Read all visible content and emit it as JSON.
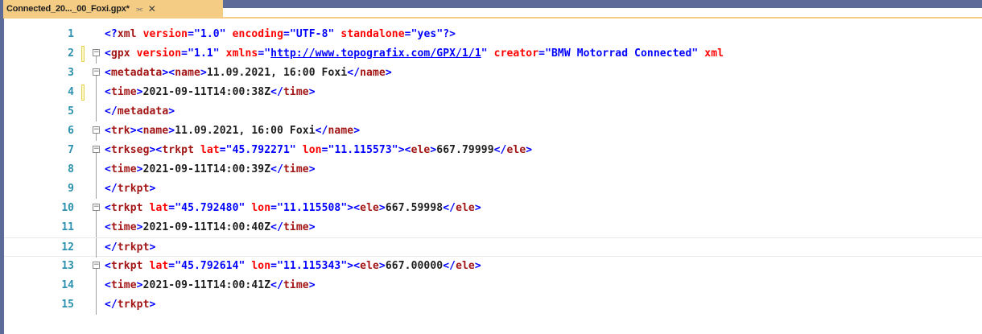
{
  "tab": {
    "title": "Connected_20..._00_Foxi.gpx*",
    "pin_icon": "pin-icon",
    "close_icon": "close-icon"
  },
  "editor": {
    "lines": [
      {
        "num": "1",
        "segments": [
          {
            "t": "<?",
            "c": "br"
          },
          {
            "t": "xml",
            "c": "tag"
          },
          {
            "t": " ",
            "c": "txt"
          },
          {
            "t": "version",
            "c": "attr"
          },
          {
            "t": "=\"",
            "c": "br"
          },
          {
            "t": "1.0",
            "c": "val"
          },
          {
            "t": "\"",
            "c": "br"
          },
          {
            "t": " ",
            "c": "txt"
          },
          {
            "t": "encoding",
            "c": "attr"
          },
          {
            "t": "=\"",
            "c": "br"
          },
          {
            "t": "UTF-8",
            "c": "val"
          },
          {
            "t": "\"",
            "c": "br"
          },
          {
            "t": " ",
            "c": "txt"
          },
          {
            "t": "standalone",
            "c": "attr"
          },
          {
            "t": "=\"",
            "c": "br"
          },
          {
            "t": "yes",
            "c": "val"
          },
          {
            "t": "\"?>",
            "c": "br"
          }
        ]
      },
      {
        "num": "2",
        "segments": [
          {
            "t": "<",
            "c": "br"
          },
          {
            "t": "gpx",
            "c": "tag"
          },
          {
            "t": " ",
            "c": "txt"
          },
          {
            "t": "version",
            "c": "attr"
          },
          {
            "t": "=\"",
            "c": "br"
          },
          {
            "t": "1.1",
            "c": "val"
          },
          {
            "t": "\"",
            "c": "br"
          },
          {
            "t": " ",
            "c": "txt"
          },
          {
            "t": "xmlns",
            "c": "attr"
          },
          {
            "t": "=\"",
            "c": "br"
          },
          {
            "t": "http://www.topografix.com/GPX/1/1",
            "c": "link"
          },
          {
            "t": "\"",
            "c": "br"
          },
          {
            "t": " ",
            "c": "txt"
          },
          {
            "t": "creator",
            "c": "attr"
          },
          {
            "t": "=\"",
            "c": "br"
          },
          {
            "t": "BMW Motorrad Connected",
            "c": "val"
          },
          {
            "t": "\"",
            "c": "br"
          },
          {
            "t": " ",
            "c": "txt"
          },
          {
            "t": "xml",
            "c": "attr"
          }
        ]
      },
      {
        "num": "3",
        "segments": [
          {
            "t": "<",
            "c": "br"
          },
          {
            "t": "metadata",
            "c": "tag"
          },
          {
            "t": "><",
            "c": "br"
          },
          {
            "t": "name",
            "c": "tag"
          },
          {
            "t": ">",
            "c": "br"
          },
          {
            "t": "11.09.2021, 16:00 Foxi",
            "c": "txt"
          },
          {
            "t": "</",
            "c": "br"
          },
          {
            "t": "name",
            "c": "tag"
          },
          {
            "t": ">",
            "c": "br"
          }
        ]
      },
      {
        "num": "4",
        "segments": [
          {
            "t": "<",
            "c": "br"
          },
          {
            "t": "time",
            "c": "tag"
          },
          {
            "t": ">",
            "c": "br"
          },
          {
            "t": "2021-09-11T14:00:38Z",
            "c": "txt"
          },
          {
            "t": "</",
            "c": "br"
          },
          {
            "t": "time",
            "c": "tag"
          },
          {
            "t": ">",
            "c": "br"
          }
        ]
      },
      {
        "num": "5",
        "segments": [
          {
            "t": "</",
            "c": "br"
          },
          {
            "t": "metadata",
            "c": "tag"
          },
          {
            "t": ">",
            "c": "br"
          }
        ]
      },
      {
        "num": "6",
        "segments": [
          {
            "t": "<",
            "c": "br"
          },
          {
            "t": "trk",
            "c": "tag"
          },
          {
            "t": "><",
            "c": "br"
          },
          {
            "t": "name",
            "c": "tag"
          },
          {
            "t": ">",
            "c": "br"
          },
          {
            "t": "11.09.2021, 16:00 Foxi",
            "c": "txt"
          },
          {
            "t": "</",
            "c": "br"
          },
          {
            "t": "name",
            "c": "tag"
          },
          {
            "t": ">",
            "c": "br"
          }
        ]
      },
      {
        "num": "7",
        "segments": [
          {
            "t": "<",
            "c": "br"
          },
          {
            "t": "trkseg",
            "c": "tag"
          },
          {
            "t": "><",
            "c": "br"
          },
          {
            "t": "trkpt",
            "c": "tag"
          },
          {
            "t": " ",
            "c": "txt"
          },
          {
            "t": "lat",
            "c": "attr"
          },
          {
            "t": "=\"",
            "c": "br"
          },
          {
            "t": "45.792271",
            "c": "val"
          },
          {
            "t": "\"",
            "c": "br"
          },
          {
            "t": " ",
            "c": "txt"
          },
          {
            "t": "lon",
            "c": "attr"
          },
          {
            "t": "=\"",
            "c": "br"
          },
          {
            "t": "11.115573",
            "c": "val"
          },
          {
            "t": "\"><",
            "c": "br"
          },
          {
            "t": "ele",
            "c": "tag"
          },
          {
            "t": ">",
            "c": "br"
          },
          {
            "t": "667.79999",
            "c": "txt"
          },
          {
            "t": "</",
            "c": "br"
          },
          {
            "t": "ele",
            "c": "tag"
          },
          {
            "t": ">",
            "c": "br"
          }
        ]
      },
      {
        "num": "8",
        "segments": [
          {
            "t": "<",
            "c": "br"
          },
          {
            "t": "time",
            "c": "tag"
          },
          {
            "t": ">",
            "c": "br"
          },
          {
            "t": "2021-09-11T14:00:39Z",
            "c": "txt"
          },
          {
            "t": "</",
            "c": "br"
          },
          {
            "t": "time",
            "c": "tag"
          },
          {
            "t": ">",
            "c": "br"
          }
        ]
      },
      {
        "num": "9",
        "segments": [
          {
            "t": "</",
            "c": "br"
          },
          {
            "t": "trkpt",
            "c": "tag"
          },
          {
            "t": ">",
            "c": "br"
          }
        ]
      },
      {
        "num": "10",
        "segments": [
          {
            "t": "<",
            "c": "br"
          },
          {
            "t": "trkpt",
            "c": "tag"
          },
          {
            "t": " ",
            "c": "txt"
          },
          {
            "t": "lat",
            "c": "attr"
          },
          {
            "t": "=\"",
            "c": "br"
          },
          {
            "t": "45.792480",
            "c": "val"
          },
          {
            "t": "\"",
            "c": "br"
          },
          {
            "t": " ",
            "c": "txt"
          },
          {
            "t": "lon",
            "c": "attr"
          },
          {
            "t": "=\"",
            "c": "br"
          },
          {
            "t": "11.115508",
            "c": "val"
          },
          {
            "t": "\"><",
            "c": "br"
          },
          {
            "t": "ele",
            "c": "tag"
          },
          {
            "t": ">",
            "c": "br"
          },
          {
            "t": "667.59998",
            "c": "txt"
          },
          {
            "t": "</",
            "c": "br"
          },
          {
            "t": "ele",
            "c": "tag"
          },
          {
            "t": ">",
            "c": "br"
          }
        ]
      },
      {
        "num": "11",
        "segments": [
          {
            "t": "<",
            "c": "br"
          },
          {
            "t": "time",
            "c": "tag"
          },
          {
            "t": ">",
            "c": "br"
          },
          {
            "t": "2021-09-11T14:00:40Z",
            "c": "txt"
          },
          {
            "t": "</",
            "c": "br"
          },
          {
            "t": "time",
            "c": "tag"
          },
          {
            "t": ">",
            "c": "br"
          }
        ]
      },
      {
        "num": "12",
        "segments": [
          {
            "t": "</",
            "c": "br"
          },
          {
            "t": "trkpt",
            "c": "tag"
          },
          {
            "t": ">",
            "c": "br"
          }
        ]
      },
      {
        "num": "13",
        "segments": [
          {
            "t": "<",
            "c": "br"
          },
          {
            "t": "trkpt",
            "c": "tag"
          },
          {
            "t": " ",
            "c": "txt"
          },
          {
            "t": "lat",
            "c": "attr"
          },
          {
            "t": "=\"",
            "c": "br"
          },
          {
            "t": "45.792614",
            "c": "val"
          },
          {
            "t": "\"",
            "c": "br"
          },
          {
            "t": " ",
            "c": "txt"
          },
          {
            "t": "lon",
            "c": "attr"
          },
          {
            "t": "=\"",
            "c": "br"
          },
          {
            "t": "11.115343",
            "c": "val"
          },
          {
            "t": "\"><",
            "c": "br"
          },
          {
            "t": "ele",
            "c": "tag"
          },
          {
            "t": ">",
            "c": "br"
          },
          {
            "t": "667.00000",
            "c": "txt"
          },
          {
            "t": "</",
            "c": "br"
          },
          {
            "t": "ele",
            "c": "tag"
          },
          {
            "t": ">",
            "c": "br"
          }
        ]
      },
      {
        "num": "14",
        "segments": [
          {
            "t": "<",
            "c": "br"
          },
          {
            "t": "time",
            "c": "tag"
          },
          {
            "t": ">",
            "c": "br"
          },
          {
            "t": "2021-09-11T14:00:41Z",
            "c": "txt"
          },
          {
            "t": "</",
            "c": "br"
          },
          {
            "t": "time",
            "c": "tag"
          },
          {
            "t": ">",
            "c": "br"
          }
        ]
      },
      {
        "num": "15",
        "segments": [
          {
            "t": "</",
            "c": "br"
          },
          {
            "t": "trkpt",
            "c": "tag"
          },
          {
            "t": ">",
            "c": "br"
          }
        ]
      }
    ]
  },
  "colors": {
    "tab_active": "#f5cc84",
    "frame": "#5d6b99",
    "line_number": "#2b91af",
    "tag": "#a31515",
    "bracket": "#0000ff",
    "attribute": "#ff0000",
    "value": "#0000ff"
  }
}
